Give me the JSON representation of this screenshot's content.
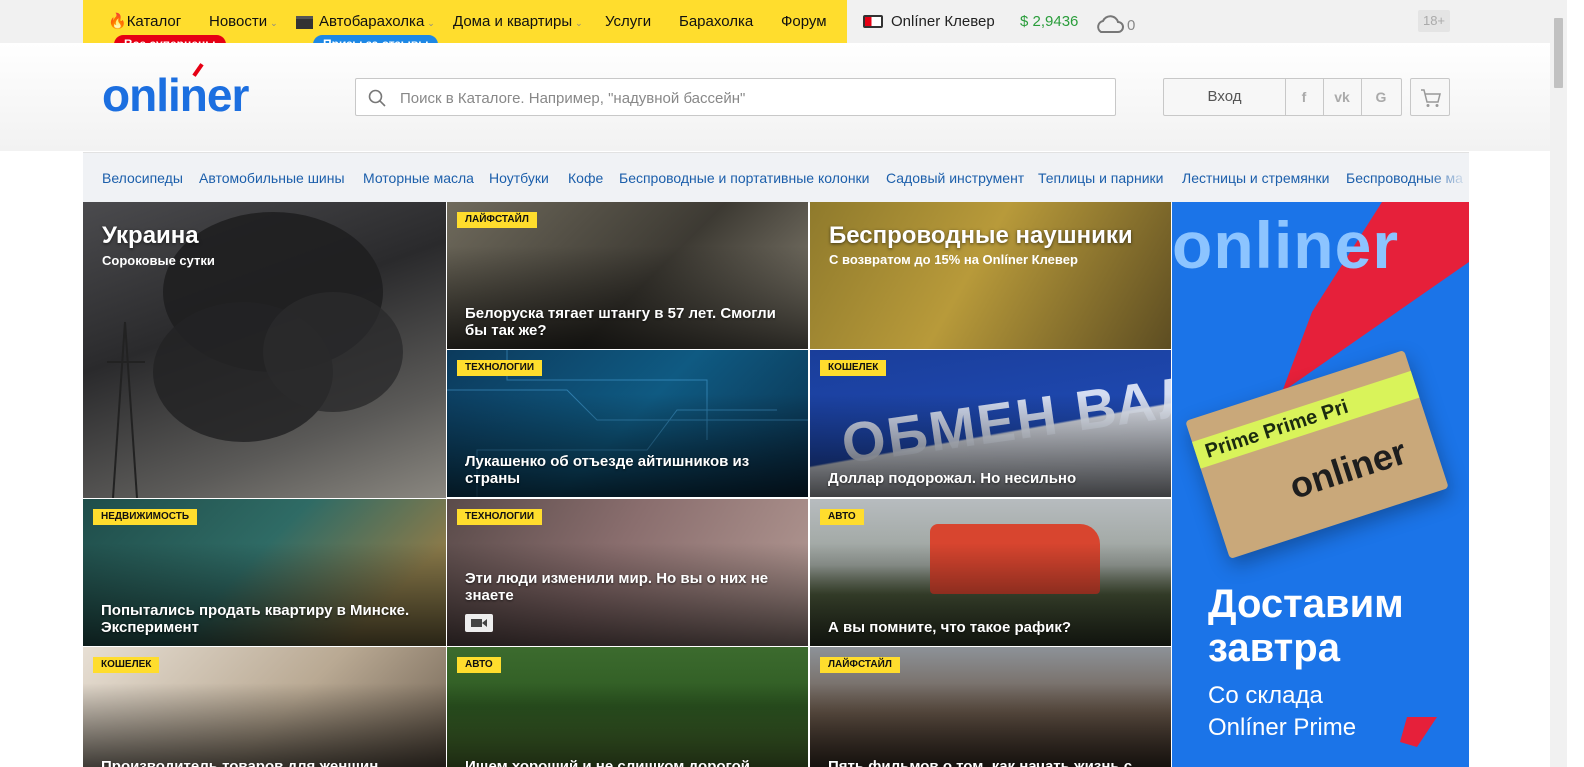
{
  "topnav": {
    "items": [
      {
        "label": "Каталог"
      },
      {
        "label": "Новости"
      },
      {
        "label": "Автобарахолка"
      },
      {
        "label": "Дома и квартиры"
      },
      {
        "label": "Услуги"
      },
      {
        "label": "Барахолка"
      },
      {
        "label": "Форум"
      }
    ],
    "pills": [
      "Все суперцены",
      "Призы за отзывы"
    ],
    "clever_label": "Onlíner Клевер",
    "currency": "$ 2,9436",
    "weather_temp": "0",
    "age_rating": "18+"
  },
  "header": {
    "logo_text": "onliner",
    "search_placeholder": "Поиск в Каталоге. Например, \"надувной бассейн\"",
    "login_label": "Вход",
    "social": [
      "f",
      "vk",
      "G"
    ]
  },
  "categories": [
    "Велосипеды",
    "Автомобильные шины",
    "Моторные масла",
    "Ноутбуки",
    "Кофе",
    "Беспроводные и портативные колонки",
    "Садовый инструмент",
    "Теплицы и парники",
    "Лестницы и стремянки",
    "Беспроводные ма"
  ],
  "news": {
    "featured": {
      "title": "Украина",
      "subtitle": "Сороковые сутки"
    },
    "promo": {
      "title": "Беспроводные наушники",
      "subtitle": "С возвратом до 15% на Onlíner Клевер"
    },
    "tiles": [
      {
        "tag": "ЛАЙФСТАЙЛ",
        "title": "Белоруска тягает штангу в 57 лет. Смогли бы так же?"
      },
      {
        "tag": "ТЕХНОЛОГИИ",
        "title": "Лукашенко об отъезде айтишников из страны"
      },
      {
        "tag": "КОШЕЛЕК",
        "title": "Доллар подорожал. Но несильно"
      },
      {
        "tag": "НЕДВИЖИМОСТЬ",
        "title": "Попытались продать квартиру в Минске. Эксперимент"
      },
      {
        "tag": "ТЕХНОЛОГИИ",
        "title": "Эти люди изменили мир. Но вы о них не знаете"
      },
      {
        "tag": "АВТО",
        "title": "А вы помните, что такое рафик?"
      },
      {
        "tag": "КОШЕЛЕК",
        "title": "Производитель товаров для женщин"
      },
      {
        "tag": "АВТО",
        "title": "Ищем хороший и не слишком дорогой"
      },
      {
        "tag": "ЛАЙФСТАЙЛ",
        "title": "Пять фильмов о том, как начать жизнь с"
      }
    ]
  },
  "ad": {
    "brand": "onliner",
    "box_text": "Prime Prime Pri",
    "box_brand": "onliner",
    "headline": "Доставим завтра",
    "sub": "Со склада Onlíner Prime"
  },
  "colors": {
    "brand_yellow": "#ffdd2d",
    "brand_blue": "#1c6fe0",
    "accent_red": "#e60014",
    "currency_green": "#2a9d3b"
  }
}
